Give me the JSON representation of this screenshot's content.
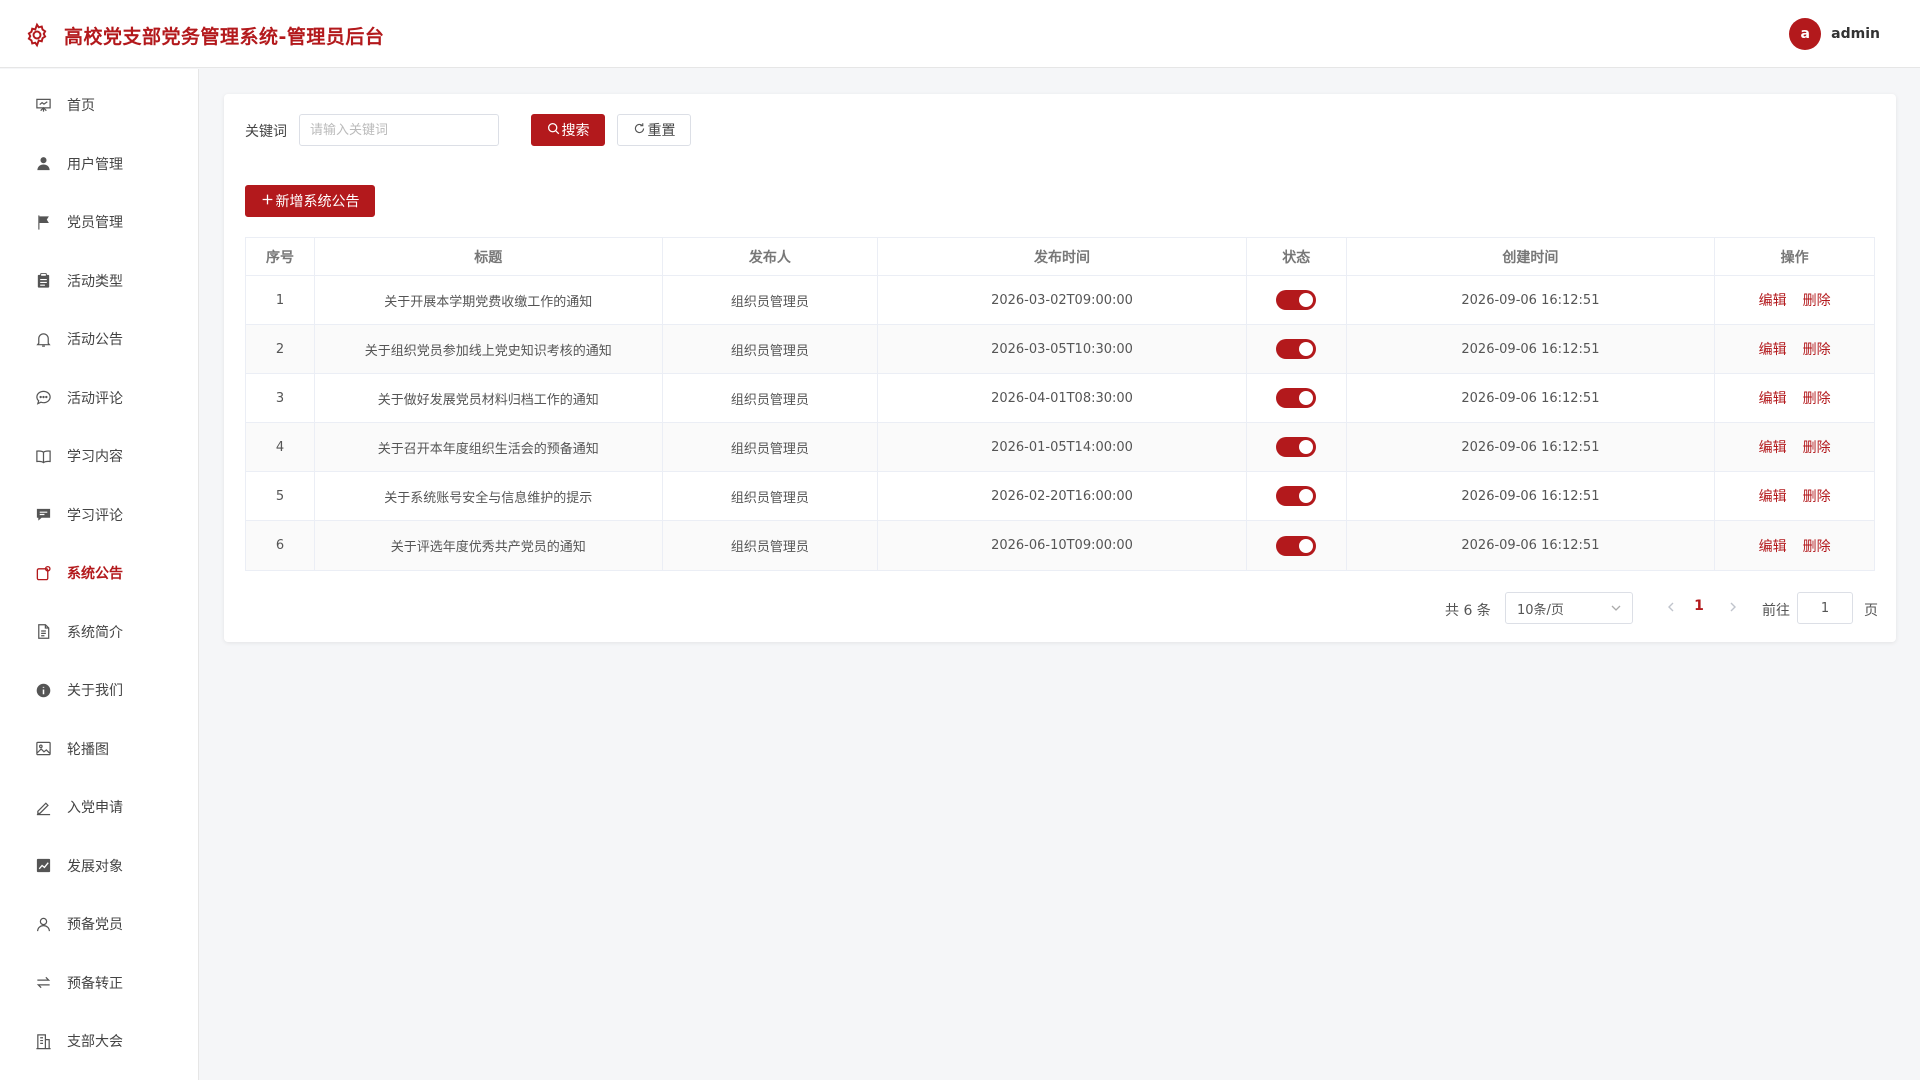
{
  "header": {
    "title": "高校党支部党务管理系统-管理员后台",
    "avatar_letter": "a",
    "username": "admin",
    "brand_color": "#b3191c"
  },
  "sidebar": {
    "items": [
      {
        "label": "首页",
        "icon": "presentation-icon"
      },
      {
        "label": "用户管理",
        "icon": "user-icon"
      },
      {
        "label": "党员管理",
        "icon": "flag-icon"
      },
      {
        "label": "活动类型",
        "icon": "clipboard-icon"
      },
      {
        "label": "活动公告",
        "icon": "bell-icon"
      },
      {
        "label": "活动评论",
        "icon": "chat-icon"
      },
      {
        "label": "学习内容",
        "icon": "book-icon"
      },
      {
        "label": "学习评论",
        "icon": "message-icon"
      },
      {
        "label": "系统公告",
        "icon": "notice-icon",
        "active": true
      },
      {
        "label": "系统简介",
        "icon": "document-icon"
      },
      {
        "label": "关于我们",
        "icon": "info-icon"
      },
      {
        "label": "轮播图",
        "icon": "image-icon"
      },
      {
        "label": "入党申请",
        "icon": "edit-icon"
      },
      {
        "label": "发展对象",
        "icon": "trend-icon"
      },
      {
        "label": "预备党员",
        "icon": "person-icon"
      },
      {
        "label": "预备转正",
        "icon": "switch-icon"
      },
      {
        "label": "支部大会",
        "icon": "building-icon"
      }
    ]
  },
  "search": {
    "label": "关键词",
    "placeholder": "请输入关键词",
    "search_label": "搜索",
    "reset_label": "重置"
  },
  "toolbar": {
    "add_label": "新增系统公告"
  },
  "table": {
    "headers": [
      "序号",
      "标题",
      "发布人",
      "发布时间",
      "状态",
      "创建时间",
      "操作"
    ],
    "rows": [
      {
        "no": "1",
        "title": "关于开展本学期党费收缴工作的通知",
        "publisher": "组织员管理员",
        "publish_time": "2026-03-02T09:00:00",
        "status": true,
        "created": "2026-09-06 16:12:51"
      },
      {
        "no": "2",
        "title": "关于组织党员参加线上党史知识考核的通知",
        "publisher": "组织员管理员",
        "publish_time": "2026-03-05T10:30:00",
        "status": true,
        "created": "2026-09-06 16:12:51"
      },
      {
        "no": "3",
        "title": "关于做好发展党员材料归档工作的通知",
        "publisher": "组织员管理员",
        "publish_time": "2026-04-01T08:30:00",
        "status": true,
        "created": "2026-09-06 16:12:51"
      },
      {
        "no": "4",
        "title": "关于召开本年度组织生活会的预备通知",
        "publisher": "组织员管理员",
        "publish_time": "2026-01-05T14:00:00",
        "status": true,
        "created": "2026-09-06 16:12:51"
      },
      {
        "no": "5",
        "title": "关于系统账号安全与信息维护的提示",
        "publisher": "组织员管理员",
        "publish_time": "2026-02-20T16:00:00",
        "status": true,
        "created": "2026-09-06 16:12:51"
      },
      {
        "no": "6",
        "title": "关于评选年度优秀共产党员的通知",
        "publisher": "组织员管理员",
        "publish_time": "2026-06-10T09:00:00",
        "status": true,
        "created": "2026-09-06 16:12:51"
      }
    ],
    "edit_label": "编辑",
    "delete_label": "删除"
  },
  "pagination": {
    "total_text": "共 6 条",
    "page_size": "10条/页",
    "current_page": "1",
    "goto_label": "前往",
    "goto_value": "1",
    "page_suffix": "页"
  }
}
